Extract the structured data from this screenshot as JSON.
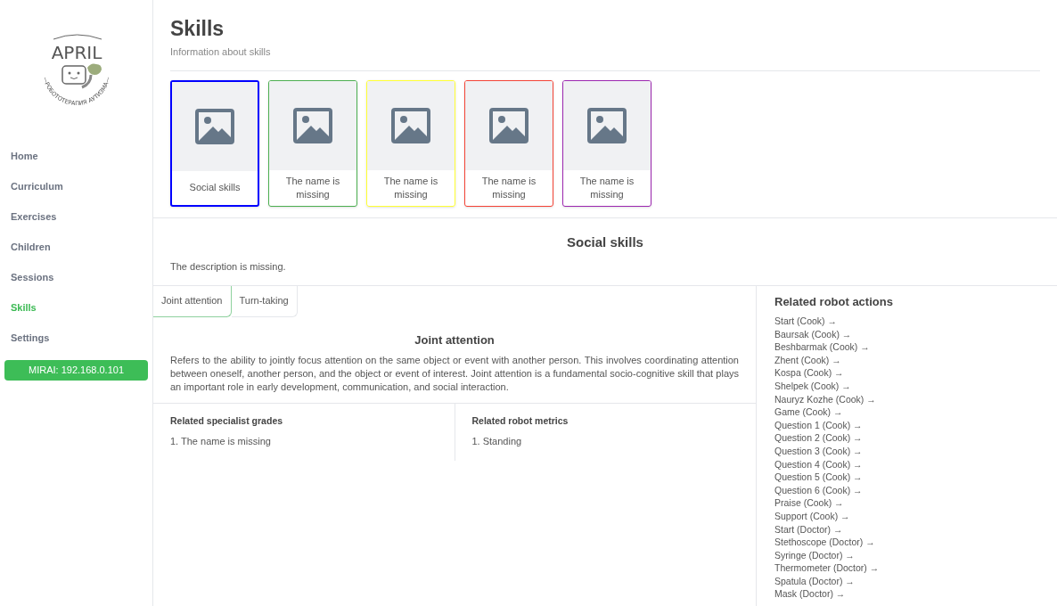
{
  "logo": {
    "title": "APRIL",
    "tagline": "—РОБОТОТЕРАПИЯ АУТИЗМА—"
  },
  "sidebar": {
    "items": [
      {
        "label": "Home",
        "selected": false
      },
      {
        "label": "Curriculum",
        "selected": false
      },
      {
        "label": "Exercises",
        "selected": false
      },
      {
        "label": "Children",
        "selected": false
      },
      {
        "label": "Sessions",
        "selected": false
      },
      {
        "label": "Skills",
        "selected": true
      },
      {
        "label": "Settings",
        "selected": false
      }
    ],
    "robot_button": "MIRAI: 192.168.0.101"
  },
  "header": {
    "title": "Skills",
    "subtitle": "Information about skills"
  },
  "skill_cards": [
    {
      "name": "Social skills",
      "color": "#0000ff",
      "selected": true
    },
    {
      "name": "The name is missing",
      "color": "#4caf50",
      "selected": false
    },
    {
      "name": "The name is missing",
      "color": "#ffff33",
      "selected": false
    },
    {
      "name": "The name is missing",
      "color": "#f44336",
      "selected": false
    },
    {
      "name": "The name is missing",
      "color": "#9c27b0",
      "selected": false
    }
  ],
  "skill": {
    "title": "Social skills",
    "description": "The description is missing."
  },
  "tabs": [
    {
      "label": "Joint attention",
      "selected": true
    },
    {
      "label": "Turn-taking",
      "selected": false
    }
  ],
  "subskill": {
    "title": "Joint attention",
    "description": "Refers to the ability to jointly focus attention on the same object or event with another person. This involves coordinating attention between oneself, another person, and the object or event of interest. Joint attention is a fundamental socio-cognitive skill that plays an important role in early development, communication, and social interaction.",
    "grades": {
      "title": "Related specialist grades",
      "items": [
        "1. The name is missing"
      ]
    },
    "metrics": {
      "title": "Related robot metrics",
      "items": [
        "1. Standing"
      ]
    }
  },
  "robot_actions": {
    "title": "Related robot actions",
    "items": [
      "Start (Cook) →",
      "Baursak (Cook) →",
      "Beshbarmak (Cook) →",
      "Zhent (Cook) →",
      "Kospa (Cook) →",
      "Shelpek (Cook) →",
      "Nauryz Kozhe (Cook) →",
      "Game (Cook) →",
      "Question 1 (Cook) →",
      "Question 2 (Cook) →",
      "Question 3 (Cook) →",
      "Question 4 (Cook) →",
      "Question 5 (Cook) →",
      "Question 6 (Cook) →",
      "Praise (Cook) →",
      "Support (Cook) →",
      "Start (Doctor) →",
      "Stethoscope (Doctor) →",
      "Syringe (Doctor) →",
      "Thermometer (Doctor) →",
      "Spatula (Doctor) →",
      "Mask (Doctor) →"
    ]
  }
}
